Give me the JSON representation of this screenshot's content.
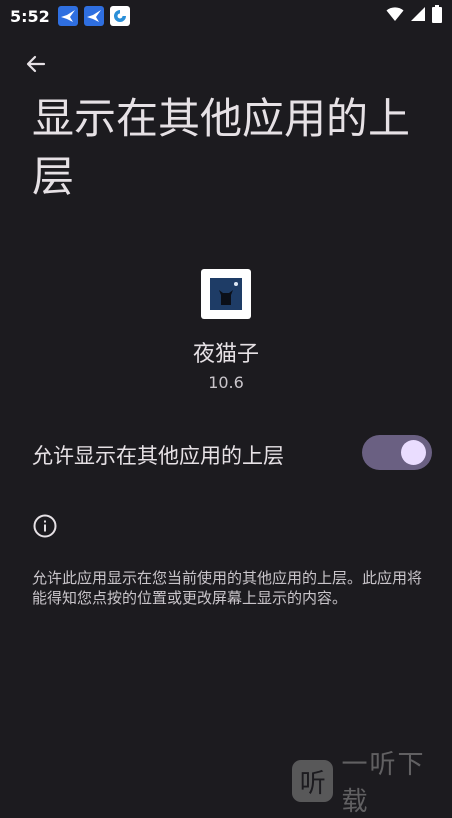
{
  "status_bar": {
    "time": "5:52",
    "notification_icons": [
      "swift-icon",
      "swift-icon",
      "browser-icon"
    ],
    "right_icons": [
      "wifi-icon",
      "signal-icon",
      "battery-icon"
    ]
  },
  "header": {
    "back_icon": "arrow-left-icon",
    "title": "显示在其他应用的上层"
  },
  "app": {
    "name": "夜猫子",
    "version": "10.6"
  },
  "setting": {
    "label": "允许显示在其他应用的上层",
    "enabled": true,
    "accent_color": "#eaddff"
  },
  "info": {
    "icon": "info-icon",
    "description": "允许此应用显示在您当前使用的其他应用的上层。此应用将能得知您点按的位置或更改屏幕上显示的内容。"
  },
  "watermark": {
    "logo_char": "听",
    "text": "一听下载"
  }
}
